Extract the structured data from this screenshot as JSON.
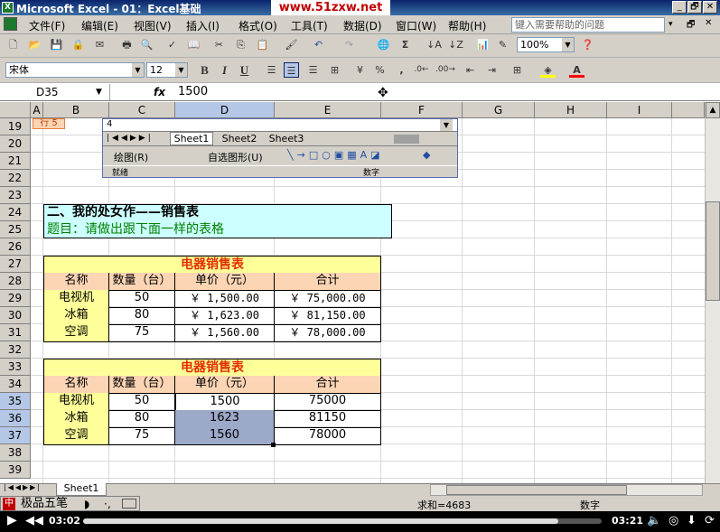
{
  "window": {
    "title": "Microsoft Excel - 01：Excel基础",
    "watermark": "www.51zxw.net",
    "buttons": [
      "_",
      "🗗",
      "✕"
    ]
  },
  "menu": {
    "items": [
      "文件(F)",
      "编辑(E)",
      "视图(V)",
      "插入(I)",
      "格式(O)",
      "工具(T)",
      "数据(D)",
      "窗口(W)",
      "帮助(H)"
    ],
    "help_placeholder": "键入需要帮助的问题"
  },
  "toolbar": {
    "zoom": "100%",
    "font_name": "宋体",
    "font_size": "12",
    "bold": "B",
    "italic": "I",
    "underline": "U",
    "percent": "%",
    "comma": ","
  },
  "formula_bar": {
    "name_box": "D35",
    "fx": "fx",
    "value": "1500"
  },
  "grid": {
    "columns": [
      "A",
      "B",
      "C",
      "D",
      "E",
      "F",
      "G",
      "H",
      "I"
    ],
    "rows": [
      "19",
      "20",
      "21",
      "22",
      "23",
      "24",
      "25",
      "26",
      "27",
      "28",
      "29",
      "30",
      "31",
      "32",
      "33",
      "34",
      "35",
      "36",
      "37",
      "38",
      "39"
    ],
    "partial_cell_b18": "行 5"
  },
  "embedded_window": {
    "row_label": "4",
    "sheet_tabs": [
      "Sheet1",
      "Sheet2",
      "Sheet3"
    ],
    "draw_label": "绘图(R)",
    "autoshape_label": "自选图形(U)",
    "status_ready": "就绪",
    "status_num": "数字"
  },
  "section": {
    "title": "二、我的处女作——销售表",
    "subtitle": "题目：请做出跟下面一样的表格"
  },
  "table1": {
    "title": "电器销售表",
    "headers": [
      "名称",
      "数量（台）",
      "单价（元）",
      "合计"
    ],
    "rows": [
      [
        "电视机",
        "50",
        "￥  1,500.00",
        "￥  75,000.00"
      ],
      [
        "冰箱",
        "80",
        "￥  1,623.00",
        "￥  81,150.00"
      ],
      [
        "空调",
        "75",
        "￥  1,560.00",
        "￥  78,000.00"
      ]
    ]
  },
  "table2": {
    "title": "电器销售表",
    "headers": [
      "名称",
      "数量（台）",
      "单价（元）",
      "合计"
    ],
    "rows": [
      [
        "电视机",
        "50",
        "1500",
        "75000"
      ],
      [
        "冰箱",
        "80",
        "1623",
        "81150"
      ],
      [
        "空调",
        "75",
        "1560",
        "78000"
      ]
    ]
  },
  "sheet_tab": "Sheet1",
  "ime": {
    "label": "极品五笔"
  },
  "status": {
    "sum": "求和=4683",
    "num": "数字"
  },
  "player": {
    "current": "03:02",
    "total": "03:21",
    "progress": 0.917
  },
  "colors": {
    "title_fill": "#ccffff",
    "header_fill": "#fcd5b4",
    "table_title_fill": "#ffff99",
    "name_fill": "#ffff99",
    "selection_fill": "#9ca9c9",
    "title_red": "#e03000",
    "subtitle_green": "#008000"
  }
}
